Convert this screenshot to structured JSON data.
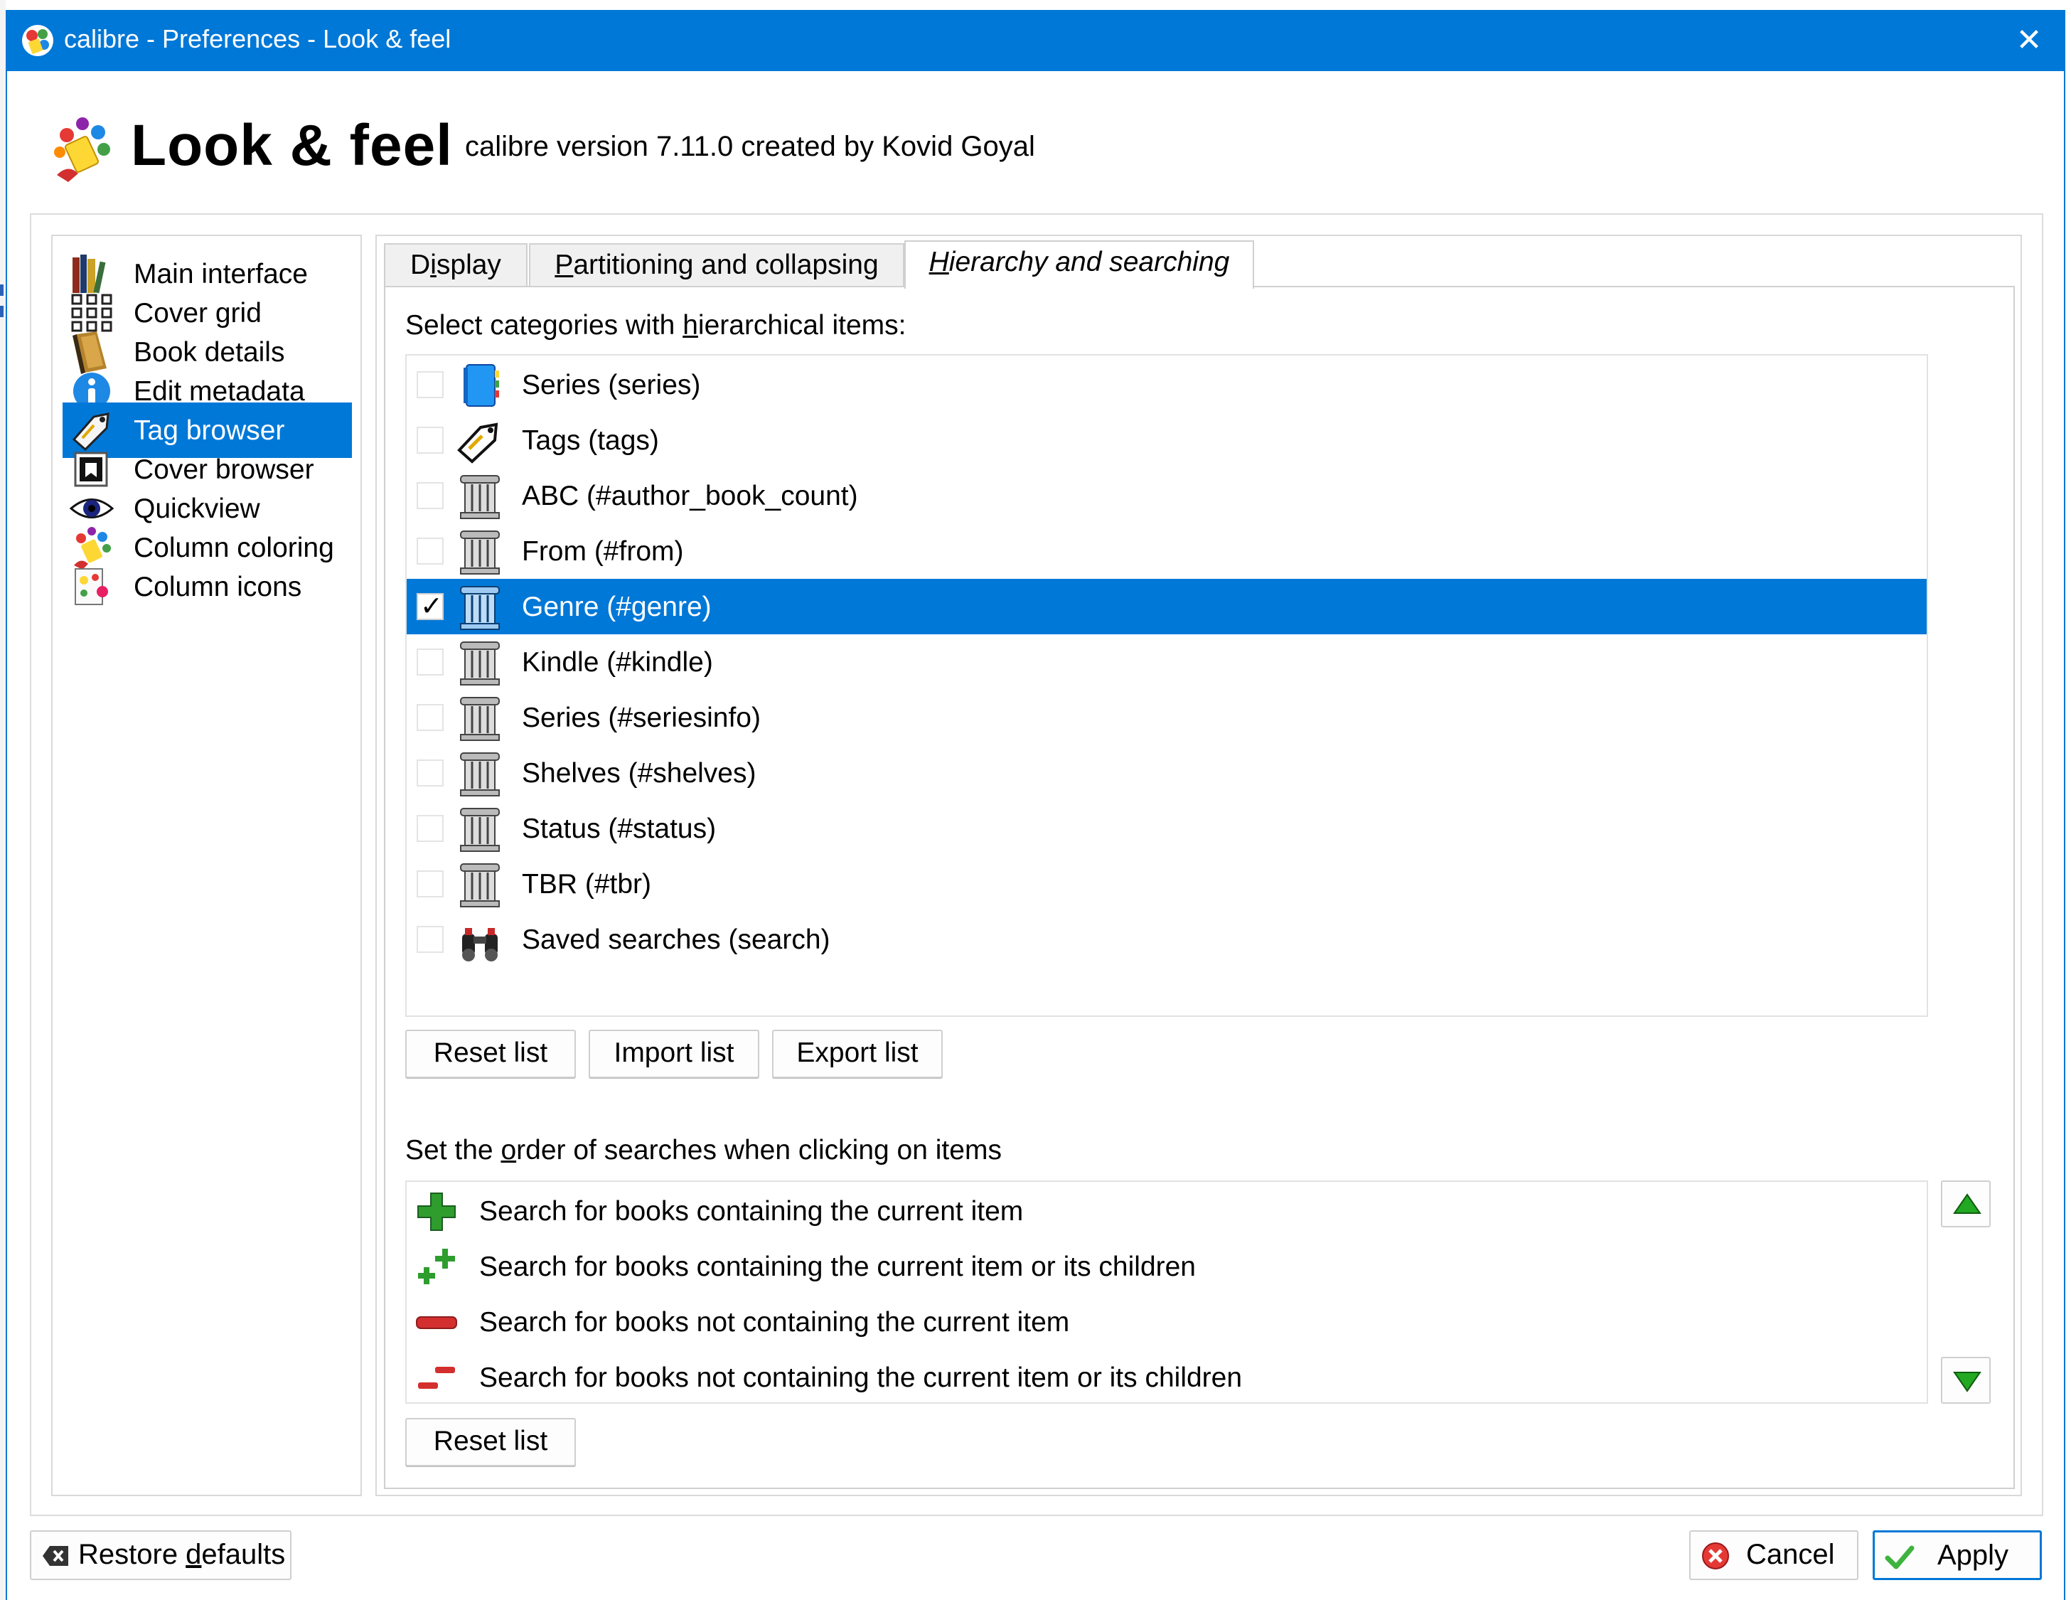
{
  "window": {
    "title": "calibre - Preferences - Look & feel",
    "close_glyph": "✕"
  },
  "header": {
    "title": "Look & feel",
    "version": "calibre version 7.11.0 created by Kovid Goyal",
    "icon": "look-and-feel-icon"
  },
  "sidebar": {
    "items": [
      {
        "label": "Main interface",
        "icon": "books-icon",
        "active": false
      },
      {
        "label": "Cover grid",
        "icon": "grid-icon",
        "active": false
      },
      {
        "label": "Book details",
        "icon": "book-icon",
        "active": false
      },
      {
        "label": "Edit metadata",
        "icon": "info-icon",
        "active": false
      },
      {
        "label": "Tag browser",
        "icon": "tag-icon",
        "active": true
      },
      {
        "label": "Cover browser",
        "icon": "cover-browser-icon",
        "active": false
      },
      {
        "label": "Quickview",
        "icon": "eye-icon",
        "active": false
      },
      {
        "label": "Column coloring",
        "icon": "palette-icon",
        "active": false
      },
      {
        "label": "Column icons",
        "icon": "column-icons-icon",
        "active": false
      }
    ]
  },
  "tabs": [
    {
      "label": "Display",
      "underline": "i",
      "active": false
    },
    {
      "label": "Partitioning and collapsing",
      "underline": "P",
      "active": false
    },
    {
      "label": "Hierarchy and searching",
      "underline": "H",
      "active": true
    }
  ],
  "hierarchy": {
    "label_pre": "Select categories with ",
    "label_u": "h",
    "label_post": "ierarchical items:",
    "items": [
      {
        "label": "Series (series)",
        "icon": "series-icon",
        "checked": false,
        "selected": false
      },
      {
        "label": "Tags (tags)",
        "icon": "tags-icon",
        "checked": false,
        "selected": false
      },
      {
        "label": "ABC (#author_book_count)",
        "icon": "column-icon",
        "checked": false,
        "selected": false
      },
      {
        "label": "From (#from)",
        "icon": "column-icon",
        "checked": false,
        "selected": false
      },
      {
        "label": "Genre (#genre)",
        "icon": "column-icon",
        "checked": true,
        "selected": true
      },
      {
        "label": "Kindle (#kindle)",
        "icon": "column-icon",
        "checked": false,
        "selected": false
      },
      {
        "label": "Series (#seriesinfo)",
        "icon": "column-icon",
        "checked": false,
        "selected": false
      },
      {
        "label": "Shelves (#shelves)",
        "icon": "column-icon",
        "checked": false,
        "selected": false
      },
      {
        "label": "Status (#status)",
        "icon": "column-icon",
        "checked": false,
        "selected": false
      },
      {
        "label": "TBR (#tbr)",
        "icon": "column-icon",
        "checked": false,
        "selected": false
      },
      {
        "label": "Saved searches (search)",
        "icon": "binoculars-icon",
        "checked": false,
        "selected": false
      }
    ],
    "buttons": {
      "reset": "Reset list",
      "import": "Import list",
      "export": "Export list"
    }
  },
  "search_order": {
    "label_pre": "Set the ",
    "label_u": "o",
    "label_post": "rder of searches when clicking on items",
    "items": [
      {
        "label": "Search for books containing the current item",
        "icon": "plus-icon"
      },
      {
        "label": "Search for books containing the current item or its children",
        "icon": "plus-plus-icon"
      },
      {
        "label": "Search for books not containing the current item",
        "icon": "minus-icon"
      },
      {
        "label": "Search for books not containing the current item or its children",
        "icon": "minus-minus-icon"
      }
    ],
    "reset": "Reset list",
    "up_icon": "arrow-up-icon",
    "down_icon": "arrow-down-icon"
  },
  "footer": {
    "restore_pre": "Restore ",
    "restore_u": "d",
    "restore_post": "efaults",
    "cancel": "Cancel",
    "apply": "Apply"
  },
  "colors": {
    "accent": "#0078d7",
    "selected_text": "#ffffff"
  }
}
